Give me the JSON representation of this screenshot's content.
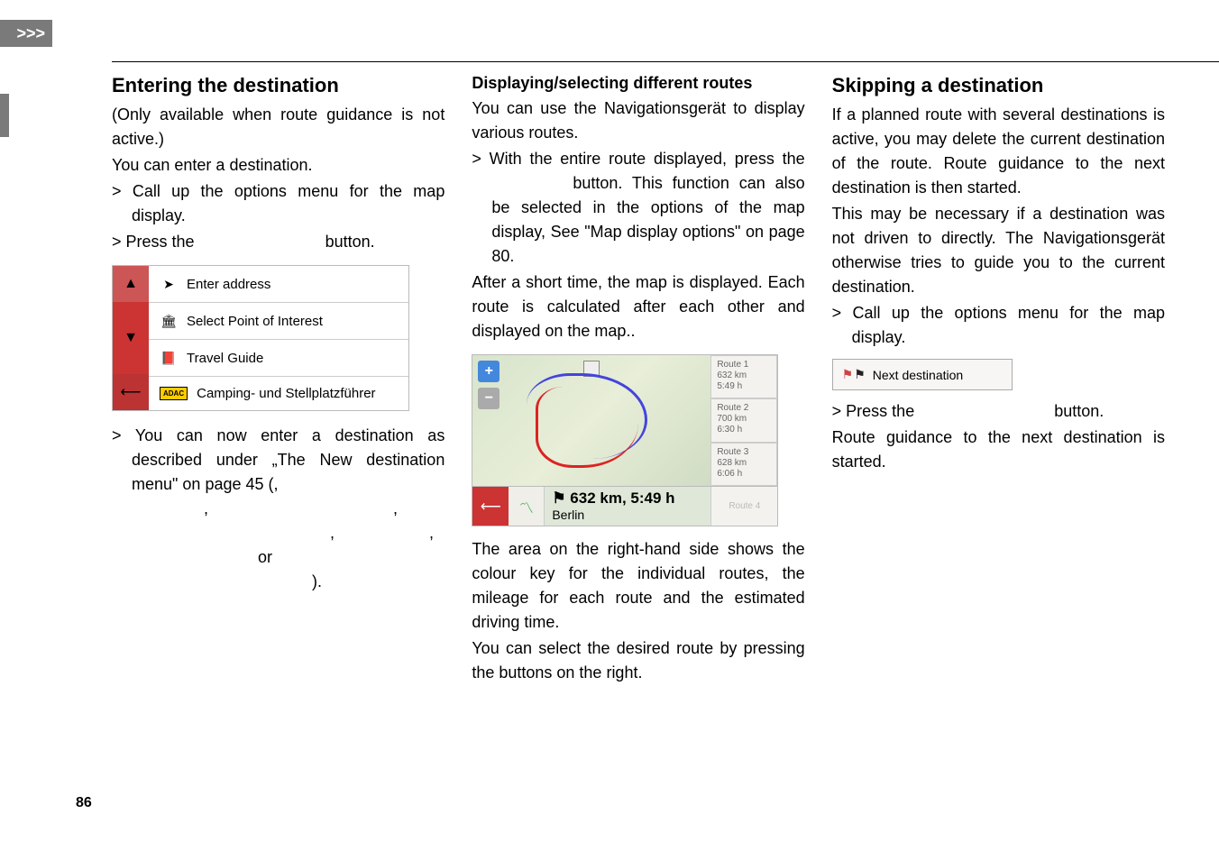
{
  "tab_marker": ">>>",
  "page_number": "86",
  "col1": {
    "heading": "Entering the destination",
    "p1": "(Only available when route guidance is not active.)",
    "p2": "You can enter a destination.",
    "step1": "> Call up the options menu for the map display.",
    "step2_a": "> Press the ",
    "step2_b": " button.",
    "menu": {
      "items": [
        {
          "icon": "arrow",
          "label": "Enter address"
        },
        {
          "icon": "poi",
          "label": "Select Point of Interest"
        },
        {
          "icon": "book",
          "label": "Travel Guide"
        },
        {
          "icon": "adac",
          "label": "Camping- und Stellplatzführer"
        }
      ]
    },
    "step3_a": "> You can now enter a destination as described under „The New destination menu\" on page 45 (",
    "step3_b": ", ",
    "step3_c": ", ",
    "step3_d": ", ",
    "step3_e": ", ",
    "step3_f": ", ",
    "step3_g": " or ",
    "step3_h": ")."
  },
  "col2": {
    "heading": "Displaying/selecting different routes",
    "p1": "You can use the Navigationsgerät to display various routes.",
    "step1_a": "> With the entire route displayed, press the ",
    "step1_b": " button. This function can also be selected in the options of the map display, See \"Map display options\" on page 80.",
    "p2": "After a short time, the map is displayed. Each route is calculated after each other and displayed on the map..",
    "routes": [
      {
        "name": "Route 1",
        "dist": "632 km",
        "time": "5:49 h"
      },
      {
        "name": "Route 2",
        "dist": "700 km",
        "time": "6:30 h"
      },
      {
        "name": "Route 3",
        "dist": "628 km",
        "time": "6:06 h"
      }
    ],
    "map_summary_dist": "632 km, 5:49 h",
    "map_summary_city": "Berlin",
    "route4": "Route 4",
    "p3": "The area on the right-hand side shows the colour key for the individual routes, the mileage for each route and the estimated driving time.",
    "p4": "You can select the desired route by pressing the buttons on the right."
  },
  "col3": {
    "heading": "Skipping a destination",
    "p1": "If a planned route with several destinations is active, you may delete the current destination of the route. Route guidance to the next destination is then started.",
    "p2": "This may be necessary if a destination was not driven to directly. The Navigationsgerät otherwise tries to guide you to the current destination.",
    "step1": "> Call up the options menu for the map display.",
    "next_dest_label": "Next destination",
    "step2_a": "> Press the ",
    "step2_b": " button.",
    "p3": "Route guidance to the next destination is started."
  }
}
